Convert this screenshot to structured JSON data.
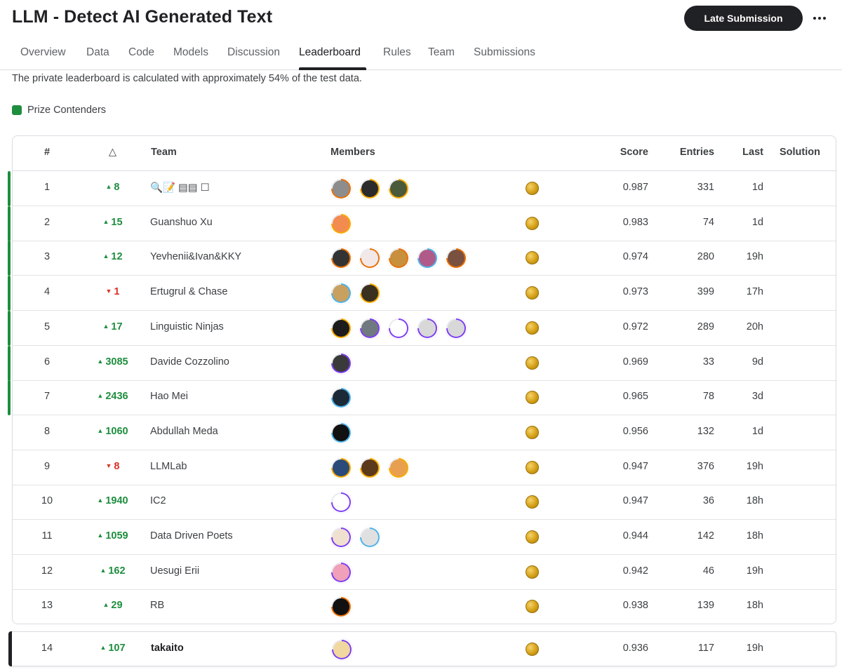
{
  "page": {
    "title": "LLM - Detect AI Generated Text",
    "late_submission_label": "Late Submission",
    "more_icon": "more-horizontal-icon"
  },
  "tabs": [
    {
      "label": "Overview"
    },
    {
      "label": "Data"
    },
    {
      "label": "Code"
    },
    {
      "label": "Models"
    },
    {
      "label": "Discussion"
    },
    {
      "label": "Leaderboard",
      "active": true
    },
    {
      "label": "Rules"
    },
    {
      "label": "Team"
    },
    {
      "label": "Submissions"
    }
  ],
  "notice": "The private leaderboard is calculated with approximately 54% of the test data.",
  "legend": {
    "label": "Prize Contenders",
    "color": "#1e8e3e"
  },
  "table": {
    "headers": {
      "rank": "#",
      "delta": "△",
      "team": "Team",
      "members": "Members",
      "score": "Score",
      "entries": "Entries",
      "last": "Last",
      "solution": "Solution"
    },
    "rows": [
      {
        "rank": "1",
        "delta": "8",
        "dir": "up",
        "team": "🔍📝 ▤▤ ☐",
        "score": "0.987",
        "entries": "331",
        "last": "1d",
        "prize": true,
        "members": [
          {
            "ring": "#e8710a",
            "fill": "#8d8d8d"
          },
          {
            "ring": "#f9ab00",
            "fill": "#2b2b2b"
          },
          {
            "ring": "#f9ab00",
            "fill": "#4a5a3a"
          }
        ]
      },
      {
        "rank": "2",
        "delta": "15",
        "dir": "up",
        "team": "Guanshuo Xu",
        "score": "0.983",
        "entries": "74",
        "last": "1d",
        "prize": true,
        "members": [
          {
            "ring": "#f9ab00",
            "fill": "#f28b50"
          }
        ]
      },
      {
        "rank": "3",
        "delta": "12",
        "dir": "up",
        "team": "Yevhenii&Ivan&KKY",
        "score": "0.974",
        "entries": "280",
        "last": "19h",
        "prize": true,
        "members": [
          {
            "ring": "#e8710a",
            "fill": "#333333"
          },
          {
            "ring": "#e8710a",
            "fill": "#f2e8e8"
          },
          {
            "ring": "#e8710a",
            "fill": "#c8903c"
          },
          {
            "ring": "#4fb3e8",
            "fill": "#b05a8a"
          },
          {
            "ring": "#e8710a",
            "fill": "#7a5040"
          }
        ]
      },
      {
        "rank": "4",
        "delta": "1",
        "dir": "down",
        "team": "Ertugrul & Chase",
        "score": "0.973",
        "entries": "399",
        "last": "17h",
        "prize": true,
        "members": [
          {
            "ring": "#4fb3e8",
            "fill": "#c8a060"
          },
          {
            "ring": "#f9ab00",
            "fill": "#3a3020"
          }
        ]
      },
      {
        "rank": "5",
        "delta": "17",
        "dir": "up",
        "team": "Linguistic Ninjas",
        "score": "0.972",
        "entries": "289",
        "last": "20h",
        "prize": true,
        "members": [
          {
            "ring": "#f9ab00",
            "fill": "#1c1c1c"
          },
          {
            "ring": "#7e3ff2",
            "fill": "#707880"
          },
          {
            "ring": "#7e3ff2",
            "fill": "#ffffff"
          },
          {
            "ring": "#7e3ff2",
            "fill": "#d8d8d8"
          },
          {
            "ring": "#7e3ff2",
            "fill": "#d8d8d8"
          }
        ]
      },
      {
        "rank": "6",
        "delta": "3085",
        "dir": "up",
        "team": "Davide Cozzolino",
        "score": "0.969",
        "entries": "33",
        "last": "9d",
        "prize": true,
        "members": [
          {
            "ring": "#7e3ff2",
            "fill": "#3a3a3a"
          }
        ]
      },
      {
        "rank": "7",
        "delta": "2436",
        "dir": "up",
        "team": "Hao Mei",
        "score": "0.965",
        "entries": "78",
        "last": "3d",
        "prize": true,
        "members": [
          {
            "ring": "#4fb3e8",
            "fill": "#1c2a38"
          }
        ]
      },
      {
        "rank": "8",
        "delta": "1060",
        "dir": "up",
        "team": "Abdullah Meda",
        "score": "0.956",
        "entries": "132",
        "last": "1d",
        "prize": false,
        "members": [
          {
            "ring": "#4fb3e8",
            "fill": "#111111"
          }
        ]
      },
      {
        "rank": "9",
        "delta": "8",
        "dir": "down",
        "team": "LLMLab",
        "score": "0.947",
        "entries": "376",
        "last": "19h",
        "prize": false,
        "members": [
          {
            "ring": "#f9ab00",
            "fill": "#2a4a7a"
          },
          {
            "ring": "#f9ab00",
            "fill": "#5a3a1a"
          },
          {
            "ring": "#f9ab00",
            "fill": "#e8a050"
          }
        ]
      },
      {
        "rank": "10",
        "delta": "1940",
        "dir": "up",
        "team": "IC2",
        "score": "0.947",
        "entries": "36",
        "last": "18h",
        "prize": false,
        "members": [
          {
            "ring": "#7e3ff2",
            "fill": "#ffffff"
          }
        ]
      },
      {
        "rank": "11",
        "delta": "1059",
        "dir": "up",
        "team": "Data Driven Poets",
        "score": "0.944",
        "entries": "142",
        "last": "18h",
        "prize": false,
        "members": [
          {
            "ring": "#7e3ff2",
            "fill": "#f0e0d0"
          },
          {
            "ring": "#4fb3e8",
            "fill": "#e0e0e0"
          }
        ]
      },
      {
        "rank": "12",
        "delta": "162",
        "dir": "up",
        "team": "Uesugi Erii",
        "score": "0.942",
        "entries": "46",
        "last": "19h",
        "prize": false,
        "members": [
          {
            "ring": "#7e3ff2",
            "fill": "#f0a0b8"
          }
        ]
      },
      {
        "rank": "13",
        "delta": "29",
        "dir": "up",
        "team": "RB",
        "score": "0.938",
        "entries": "139",
        "last": "18h",
        "prize": false,
        "members": [
          {
            "ring": "#e8710a",
            "fill": "#111111"
          }
        ]
      }
    ]
  },
  "my_row": {
    "rank": "14",
    "delta": "107",
    "dir": "up",
    "team": "takaito",
    "score": "0.936",
    "entries": "117",
    "last": "19h",
    "members": [
      {
        "ring": "#7e3ff2",
        "fill": "#f0d8a0"
      }
    ]
  }
}
